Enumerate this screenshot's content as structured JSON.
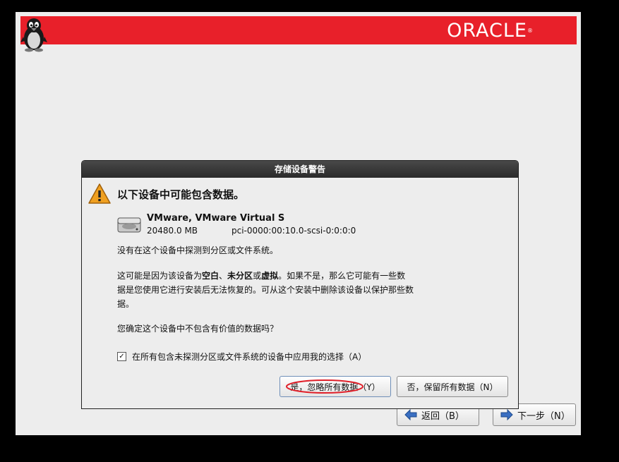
{
  "banner": {
    "logo": "ORACLE",
    "logo_mark": "®"
  },
  "navigation": {
    "back_label": "返回（B）",
    "next_label": "下一步（N）"
  },
  "dialog": {
    "title": "存储设备警告",
    "heading": "以下设备中可能包含数据。",
    "device": {
      "name": "VMware, VMware Virtual S",
      "size": "20480.0 MB",
      "path": "pci-0000:00:10.0-scsi-0:0:0:0"
    },
    "paragraph1": "没有在这个设备中探测到分区或文件系统。",
    "paragraph2": {
      "part1": "这可能是因为该设备为",
      "bold1": "空白",
      "sep1": "、",
      "bold2": "未分区",
      "sep2": "或",
      "bold3": "虚拟",
      "part2": "。如果不是，那么它可能有一些数据是您使用它进行安装后无法恢复的。可从这个安装中删除该设备以保护那些数据。"
    },
    "paragraph3": "您确定这个设备中不包含有价值的数据吗？",
    "checkbox_label": "在所有包含未探测分区或文件系统的设备中应用我的选择（A）",
    "checkbox_checked": true,
    "yes_button": "是，忽略所有数据（Y）",
    "no_button": "否，保留所有数据（N）"
  },
  "colors": {
    "banner_red": "#e8202a",
    "warning_orange": "#f0a020",
    "annotation_red": "#e0202a"
  }
}
